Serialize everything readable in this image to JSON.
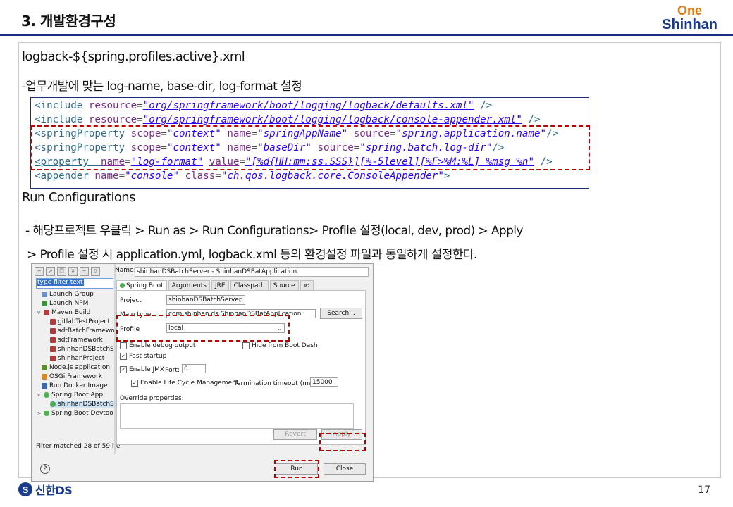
{
  "header": {
    "title": "3. 개발환경구성",
    "logo_one": "One",
    "logo_shinhan": "Shinhan"
  },
  "section1": {
    "heading": "logback-${spring.profiles.active}.xml",
    "desc": "-업무개발에 맞는 log-name, base-dir, log-format 설정"
  },
  "code": {
    "line1": {
      "tag": "<include ",
      "attr1": "resource",
      "val1": "\"org/springframework/boot/logging/logback/defaults.xml\"",
      "end": " />"
    },
    "line2": {
      "tag": "<include ",
      "attr1": "resource",
      "val1": "\"org/springframework/boot/logging/logback/console-appender.xml\"",
      "end": " />"
    },
    "line3": {
      "tag": "<springProperty ",
      "attr1": "scope",
      "val1": "\"context\"",
      "attr2": "name",
      "val2": "\"springAppName\"",
      "attr3": "source",
      "val3": "\"spring.application.name\"",
      "end": "/>"
    },
    "line4": {
      "tag": "<springProperty ",
      "attr1": "scope",
      "val1": "\"context\"",
      "attr2": "name",
      "val2": "\"baseDir\"",
      "attr3": "source",
      "val3": "\"spring.batch.log-dir\"",
      "end": "/>"
    },
    "line5": {
      "tag": "<property  ",
      "attr1": "name",
      "val1": "\"log-format\"",
      "attr2": "value",
      "val2": "\"[%d{HH:mm:ss.SSS}][%-5level][%F>%M:%L] %msg %n\"",
      "end": " />"
    },
    "line6": {
      "tag": "<appender ",
      "attr1": "name",
      "val1": "\"console\"",
      "attr2": "class",
      "val2": "\"ch.qos.logback.core.ConsoleAppender\"",
      "end": ">"
    }
  },
  "section2": {
    "heading": "Run Configurations",
    "step1": "- 해당프로젝트 우클릭 > Run as > Run Configurations> Profile 설정(local, dev, prod) > Apply",
    "step2": "> Profile 설정 시 application.yml, logback.xml 등의 환경설정 파일과 동일하게 설정한다."
  },
  "eclipse": {
    "filter_text": "type filter text",
    "tree": [
      {
        "label": "Launch Group"
      },
      {
        "label": "Launch NPM"
      },
      {
        "label": "Maven Build"
      },
      {
        "label": "gitlabTestProject"
      },
      {
        "label": "sdtBatchFramewo"
      },
      {
        "label": "sdtFramework"
      },
      {
        "label": "shinhanDSBatchS"
      },
      {
        "label": "shinhanProject"
      },
      {
        "label": "Node.js application"
      },
      {
        "label": "OSGi Framework"
      },
      {
        "label": "Run Docker Image"
      },
      {
        "label": "Spring Boot App"
      },
      {
        "label": "shinhanDSBatchS"
      },
      {
        "label": "Spring Boot Devtoo"
      }
    ],
    "filter_status": "Filter matched 28 of 59 ite",
    "name_label": "Name:",
    "name_value": "shinhanDSBatchServer - ShinhanDSBatApplication",
    "tabs": [
      "Spring Boot",
      "Arguments",
      "JRE",
      "Classpath",
      "Source",
      "»₂"
    ],
    "project_label": "Project",
    "project_value": "shinhanDSBatchServer",
    "main_type_label": "Main type",
    "main_type_value": "com.shinhan.ds.ShinhanDSBatApplication",
    "search_button": "Search...",
    "profile_label": "Profile",
    "profile_value": "local",
    "debug_output": "Enable debug output",
    "hide_boot_dash": "Hide from Boot Dash",
    "fast_startup": "Fast startup",
    "enable_jmx": "Enable JMX",
    "port_label": "Port:",
    "port_value": "0",
    "lifecycle": "Enable Life Cycle Management.",
    "termination_label": "Termination timeout (ms):",
    "termination_value": "15000",
    "override_label": "Override properties:",
    "revert_button": "Revert",
    "apply_button": "Apply",
    "run_button": "Run",
    "close_button": "Close",
    "help_icon_glyph": "?"
  },
  "footer": {
    "company": "신한DS",
    "company_mark": "S",
    "page_number": "17"
  },
  "colors": {
    "brand_navy": "#1a2f7a",
    "brand_orange": "#e07b12",
    "highlight_red": "#c00000"
  }
}
